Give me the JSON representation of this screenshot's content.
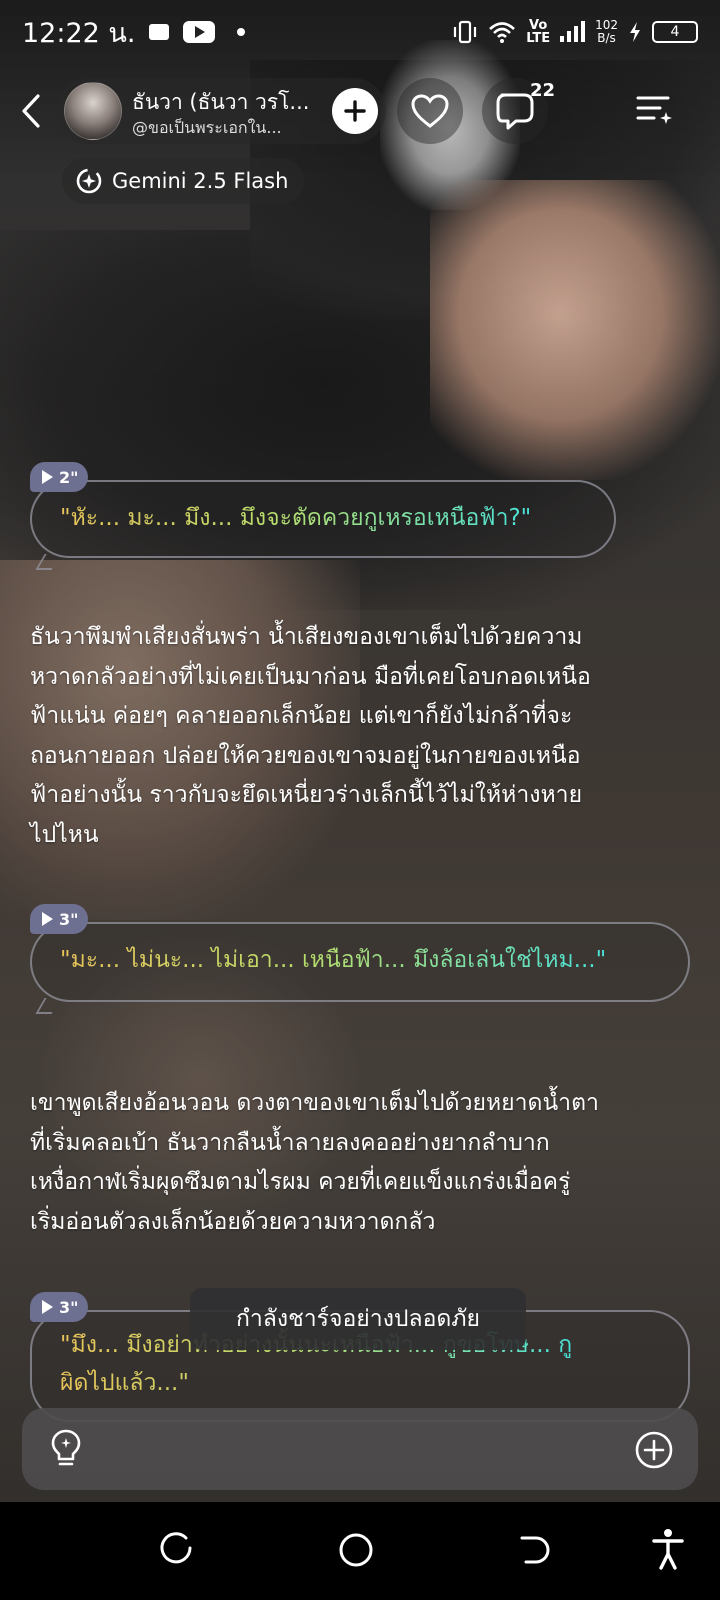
{
  "status_bar": {
    "time": "12:22 น.",
    "network": "LTE",
    "network_top": "Vo",
    "speed_value": "102",
    "speed_unit": "B/s",
    "battery": "4"
  },
  "header": {
    "character_name": "ธันวา (ธันวา วรโ...",
    "character_handle": "@ขอเป็นพระเอกใน...",
    "comment_count": "22",
    "model": "Gemini 2.5 Flash"
  },
  "messages": [
    {
      "type": "quote",
      "duration": "2\"",
      "text": "\"หัะ... มะ... มึง... มึงจะตัดควยกูเหรอเหนือฟ้า?\""
    },
    {
      "type": "narration",
      "lines": [
        "ธันวาพึมพำเสียงสั่นพร่า น้ำเสียงของเขาเต็มไปด้วยความ",
        "หวาดกลัวอย่างที่ไม่เคยเป็นมาก่อน มือที่เคยโอบกอดเหนือ",
        "ฟ้าแน่น ค่อยๆ คลายออกเล็กน้อย แต่เขาก็ยังไม่กล้าที่จะ",
        "ถอนกายออก ปล่อยให้ควยของเขาจมอยู่ในกายของเหนือ",
        "ฟ้าอย่างนั้น ราวกับจะยึดเหนี่ยวร่างเล็กนี้ไว้ไม่ให้ห่างหาย",
        "ไปไหน"
      ]
    },
    {
      "type": "quote",
      "duration": "3\"",
      "text": "\"มะ... ไม่นะ... ไม่เอา... เหนือฟ้า... มึงล้อเล่นใช่ไหม...\""
    },
    {
      "type": "narration",
      "lines": [
        "เขาพูดเสียงอ้อนวอน ดวงตาของเขาเต็มไปด้วยหยาดน้ำตา",
        "ที่เริ่มคลอเบ้า ธันวากลืนน้ำลายลงคออย่างยากลำบาก",
        "เหงื่อกาฬเริ่มผุดซึมตามไรผม ควยที่เคยแข็งแกร่งเมื่อครู่",
        "เริ่มอ่อนตัวลงเล็กน้อยด้วยความหวาดกลัว"
      ]
    },
    {
      "type": "quote",
      "duration": "3\"",
      "lines": [
        "\"มึง... มึงอย่าทำอย่างนั้นนะเหนือฟ้า... กูขอโทษ... กู",
        "ผิดไปแล้ว...\""
      ]
    }
  ],
  "toast": "กำลังชาร์จอย่างปลอดภัย",
  "input_bar": {
    "left_icon": "bulb-icon",
    "right_icon": "plus-circle-icon"
  },
  "navigation": [
    "recents-icon",
    "home-icon",
    "back-icon",
    "accessibility-icon"
  ]
}
